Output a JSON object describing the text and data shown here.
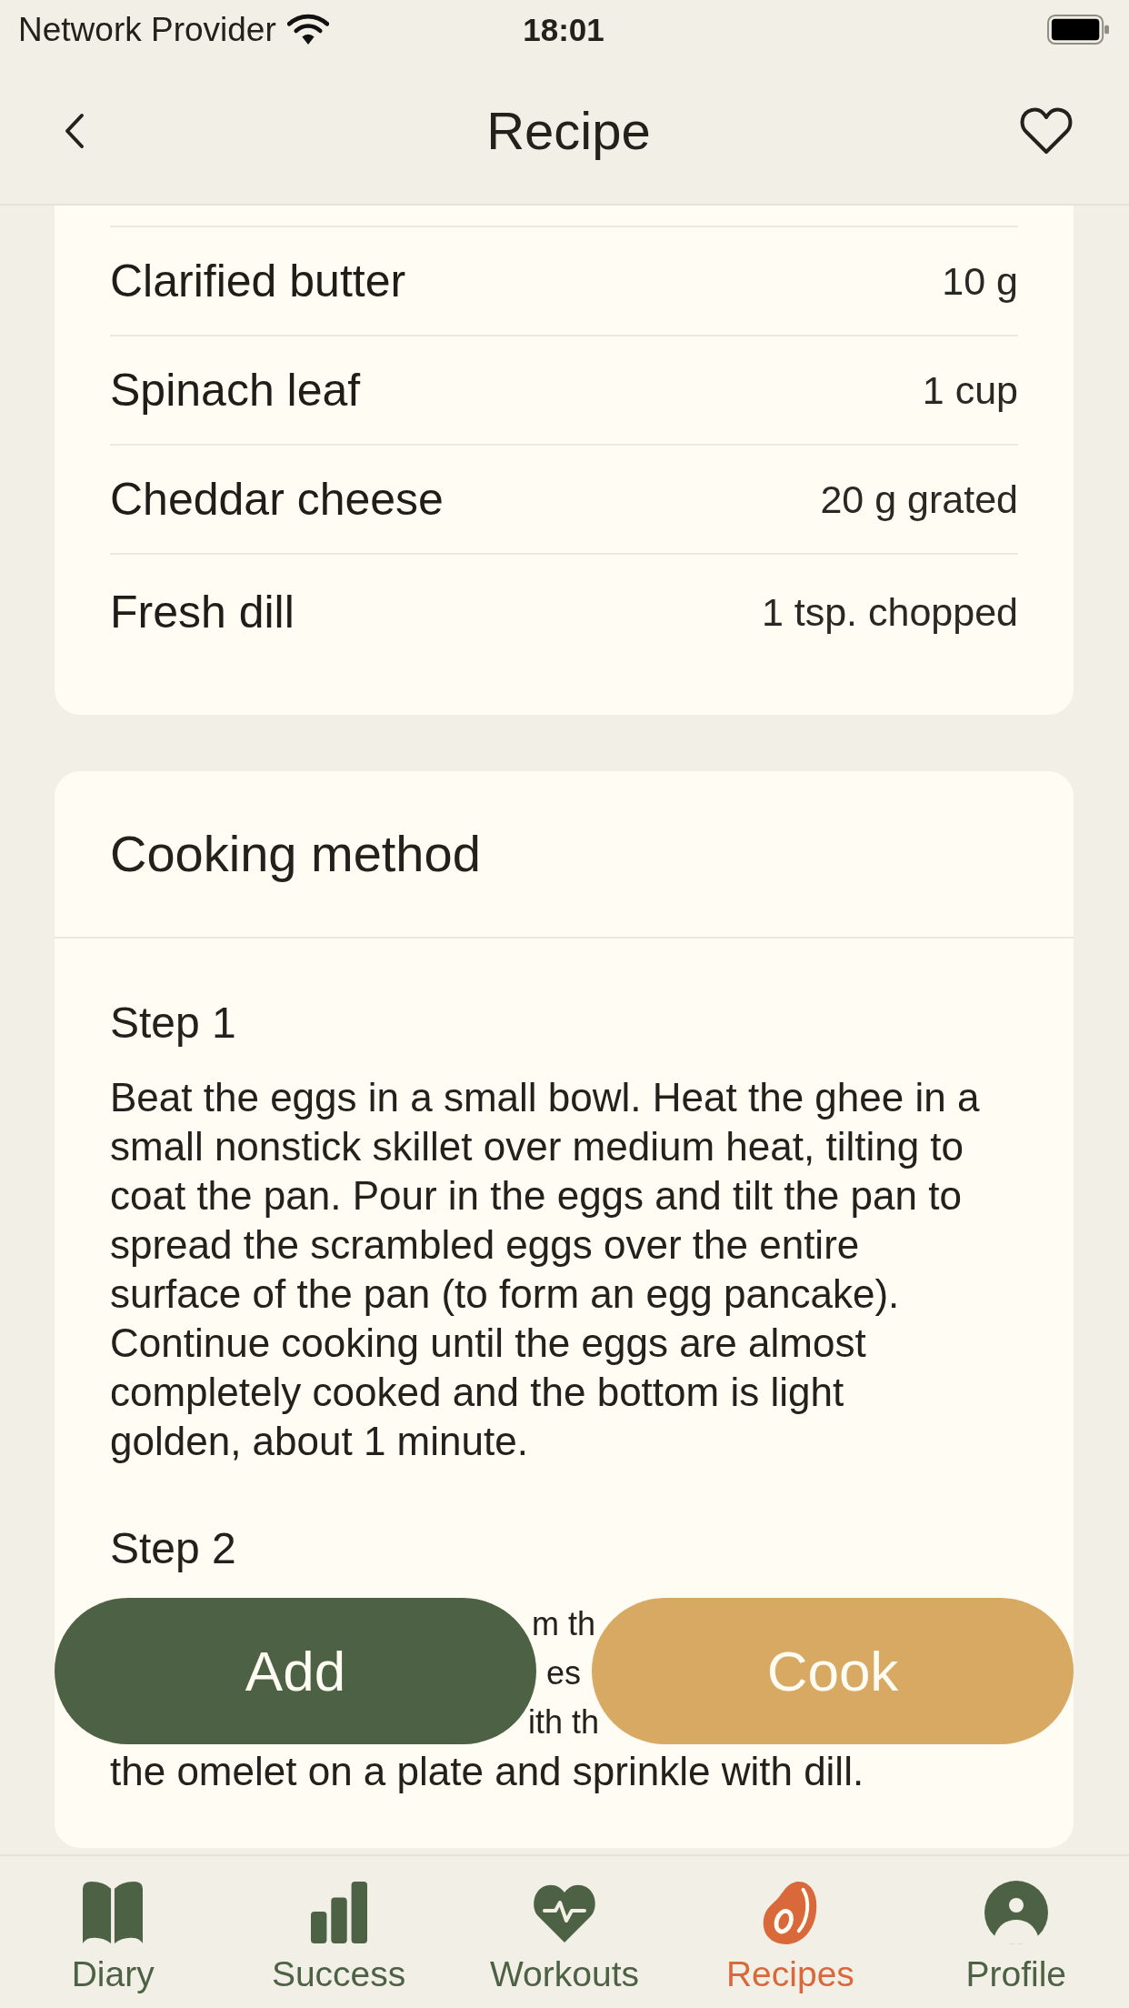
{
  "status_bar": {
    "carrier": "Network Provider",
    "time": "18:01"
  },
  "nav_bar": {
    "title": "Recipe"
  },
  "ingredients": [
    {
      "name": "Clarified butter",
      "amount": "10 g"
    },
    {
      "name": "Spinach leaf",
      "amount": "1 cup"
    },
    {
      "name": "Cheddar cheese",
      "amount": "20 g grated"
    },
    {
      "name": "Fresh dill",
      "amount": "1 tsp. chopped"
    }
  ],
  "cooking_method": {
    "title": "Cooking method",
    "steps": [
      {
        "title": "Step 1",
        "lines": [
          {
            "kind": "full",
            "text": "Beat the eggs in a small bowl. Heat the ghee in a\nsmall nonstick skillet over medium heat, tilting to\ncoat the pan. Pour in the eggs and tilt the pan to\nspread the scrambled eggs over the entire\nsurface of the pan (to form an egg pancake).\nContinue cooking until the eggs are almost\ncompletely cooked and the bottom is light\ngolden, about 1 minute."
          }
        ]
      },
      {
        "title": "Step 2",
        "lines": [
          {
            "kind": "fragment",
            "text": "m th"
          },
          {
            "kind": "fragment",
            "text": "es"
          },
          {
            "kind": "fragment",
            "text": "ith th"
          },
          {
            "kind": "full",
            "text": "the omelet on a plate and sprinkle with dill."
          }
        ]
      }
    ]
  },
  "actions": [
    {
      "label": "Add",
      "kind": "primary"
    },
    {
      "label": "Cook",
      "kind": "secondary"
    }
  ],
  "tab_bar": [
    {
      "label": "Diary",
      "selected": false
    },
    {
      "label": "Success",
      "selected": false
    },
    {
      "label": "Workouts",
      "selected": false
    },
    {
      "label": "Recipes",
      "selected": true
    },
    {
      "label": "Profile",
      "selected": false
    }
  ]
}
